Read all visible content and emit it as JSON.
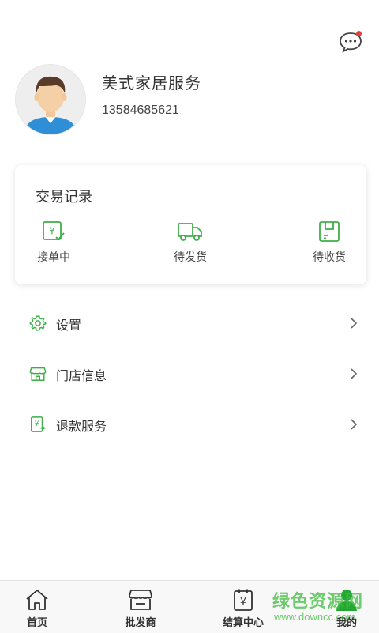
{
  "header": {
    "message_icon": "chat-bubble-icon",
    "has_unread": true
  },
  "profile": {
    "avatar_icon": "user-avatar",
    "name": "美式家居服务",
    "phone": "13584685621"
  },
  "orders": {
    "title": "交易记录",
    "items": [
      {
        "icon": "yuan-check-icon",
        "label": "接单中"
      },
      {
        "icon": "delivery-truck-icon",
        "label": "待发货"
      },
      {
        "icon": "box-icon",
        "label": "待收货"
      }
    ]
  },
  "menu": [
    {
      "icon": "gear-icon",
      "label": "设置"
    },
    {
      "icon": "store-icon",
      "label": "门店信息"
    },
    {
      "icon": "refund-icon",
      "label": "退款服务"
    }
  ],
  "tabbar": [
    {
      "icon": "home-icon",
      "label": "首页",
      "active": false
    },
    {
      "icon": "wholesale-store-icon",
      "label": "批发商",
      "active": false
    },
    {
      "icon": "settlement-icon",
      "label": "结算中心",
      "active": false
    },
    {
      "icon": "user-icon",
      "label": "我的",
      "active": true
    }
  ],
  "watermark": {
    "main": "绿色资源网",
    "sub": "www.downcc.com"
  },
  "colors": {
    "accent": "#3fae49",
    "badge": "#e0413a",
    "tab_active": "#22a833"
  }
}
